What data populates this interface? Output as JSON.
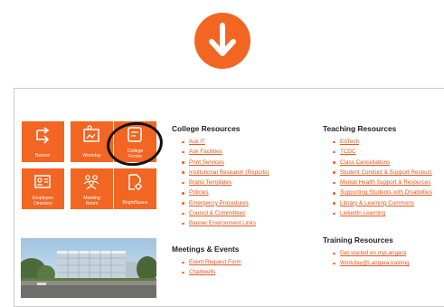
{
  "colors": {
    "accent": "#f26522",
    "link": "#e4571c",
    "heading": "#222222"
  },
  "indicator": {
    "icon": "arrow-down-icon"
  },
  "tiles": [
    {
      "label": "Banner",
      "icon": "redirect-arrow-icon"
    },
    {
      "label": "Workday",
      "icon": "workday-window-icon"
    },
    {
      "label": "College\nForms",
      "icon": "form-icon"
    },
    {
      "label": "Employee\nDirectory",
      "icon": "id-card-icon"
    },
    {
      "label": "Meeting\nRoom",
      "icon": "people-group-icon"
    },
    {
      "label": "BrightSpace",
      "icon": "document-gear-icon"
    }
  ],
  "sections": {
    "college_resources": {
      "title": "College Resources",
      "links": [
        "Ask IT",
        "Ask Facilities",
        "Print Services",
        "Institutional Research (Reports)",
        "Brand Templates",
        "Policies",
        "Emergency Procedures",
        "Council & Committees",
        "Banner Environment Links"
      ]
    },
    "meetings_events": {
      "title": "Meetings & Events",
      "links": [
        "Event Request Form",
        "Chartwells"
      ]
    },
    "teaching_resources": {
      "title": "Teaching Resources",
      "links": [
        "EdTech",
        "TCDC",
        "Class Cancellations",
        "Student Conduct & Support Resourc",
        "Mental Health Support & Resources",
        "Supporting Students with Disabilities",
        "Library & Learning Commons",
        "LinkedIn Learning"
      ]
    },
    "training_resources": {
      "title": "Training Resources",
      "links": [
        "Get started on myLangara",
        "Workday@Langara training"
      ]
    }
  }
}
